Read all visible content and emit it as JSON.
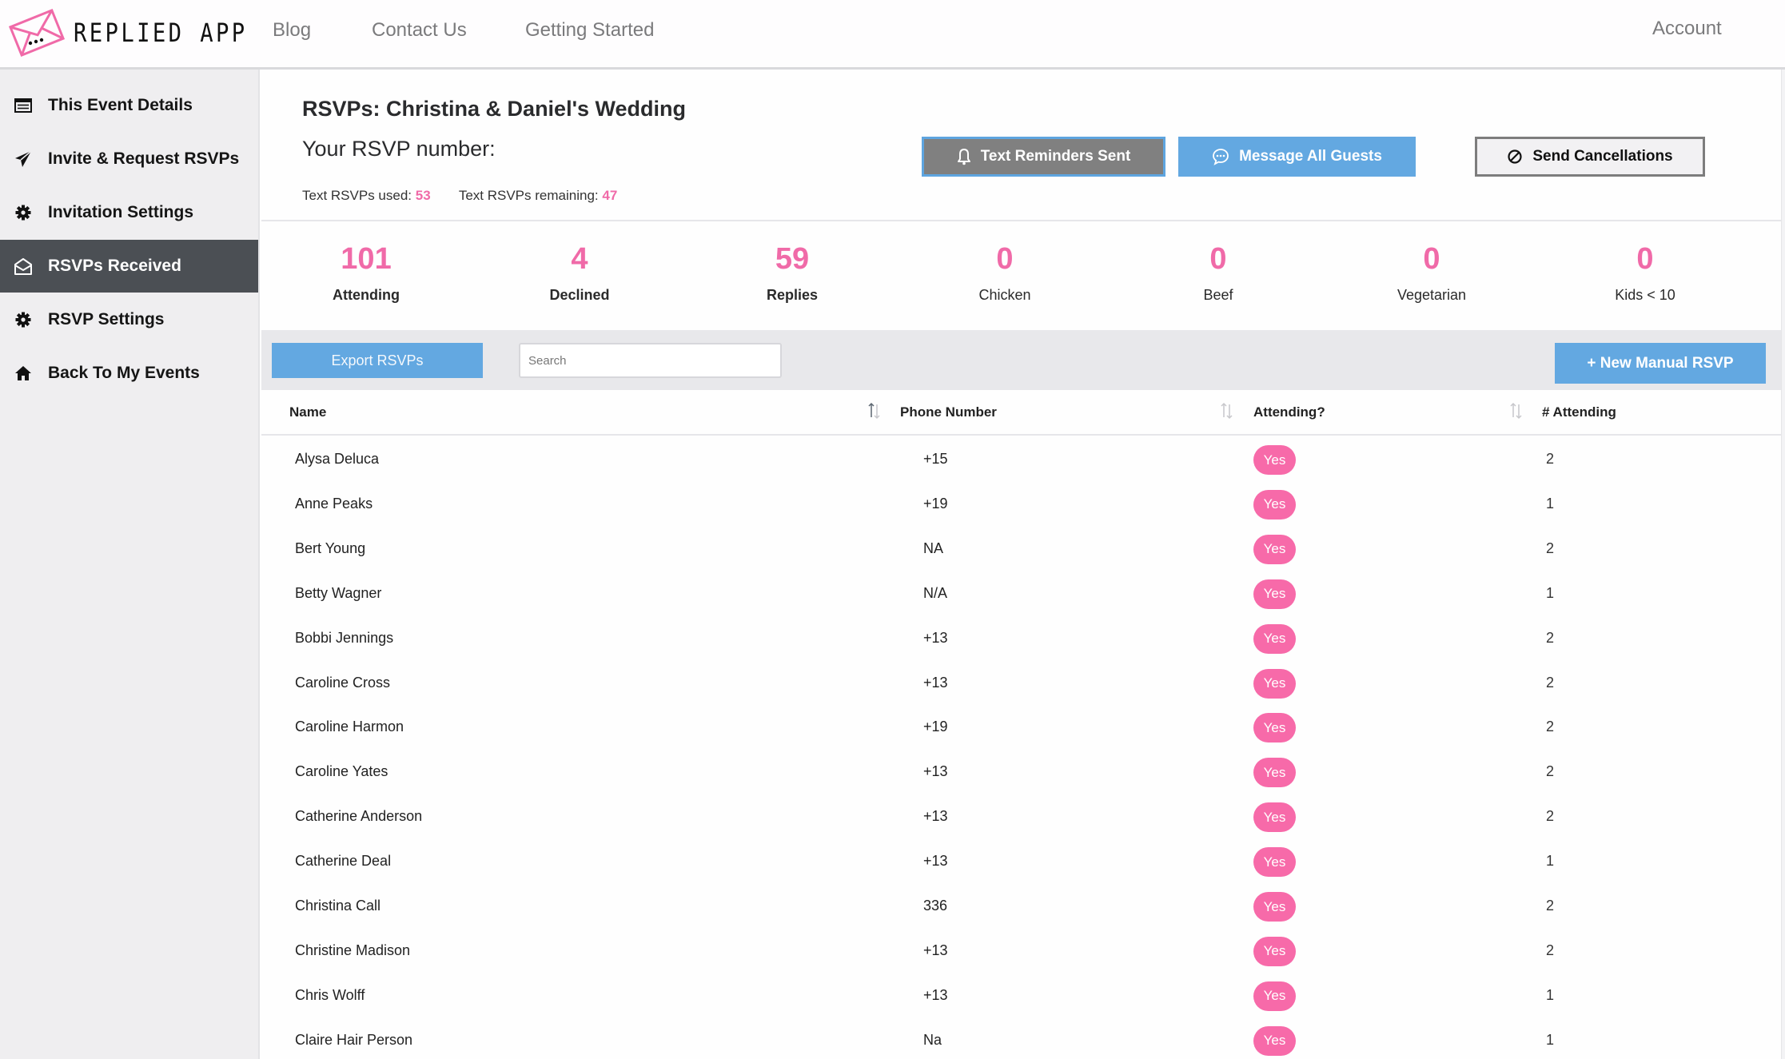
{
  "header": {
    "brand": "REPLIED APP",
    "nav": [
      "Blog",
      "Contact Us",
      "Getting Started"
    ],
    "account": "Account"
  },
  "sidebar": {
    "items": [
      {
        "label": "This Event Details",
        "icon": "list-icon"
      },
      {
        "label": "Invite & Request RSVPs",
        "icon": "paper-plane-icon"
      },
      {
        "label": "Invitation Settings",
        "icon": "gear-icon"
      },
      {
        "label": "RSVPs Received",
        "icon": "envelope-open-icon",
        "active": true
      },
      {
        "label": "RSVP Settings",
        "icon": "gear-icon"
      },
      {
        "label": "Back To My Events",
        "icon": "home-icon"
      }
    ]
  },
  "page": {
    "title": "RSVPs: Christina & Daniel's Wedding",
    "rsvp_number_label": "Your RSVP number:",
    "text_used_label": "Text RSVPs used:",
    "text_used": "53",
    "text_remaining_label": "Text RSVPs remaining:",
    "text_remaining": "47"
  },
  "actions": {
    "reminders": "Text Reminders Sent",
    "message": "Message All Guests",
    "cancel": "Send Cancellations"
  },
  "stats": [
    {
      "value": "101",
      "label": "Attending"
    },
    {
      "value": "4",
      "label": "Declined"
    },
    {
      "value": "59",
      "label": "Replies"
    },
    {
      "value": "0",
      "label": "Chicken"
    },
    {
      "value": "0",
      "label": "Beef"
    },
    {
      "value": "0",
      "label": "Vegetarian"
    },
    {
      "value": "0",
      "label": "Kids < 10"
    }
  ],
  "toolbar": {
    "export": "Export RSVPs",
    "search_placeholder": "Search",
    "search_value": "",
    "new_manual": "+ New Manual RSVP"
  },
  "table": {
    "columns": [
      "Name",
      "Phone Number",
      "Attending?",
      "# Attending"
    ],
    "rows": [
      {
        "name": "Alysa Deluca",
        "phone": "+15",
        "attending": "Yes",
        "count": "2"
      },
      {
        "name": "Anne Peaks",
        "phone": "+19",
        "attending": "Yes",
        "count": "1"
      },
      {
        "name": "Bert Young",
        "phone": "NA",
        "attending": "Yes",
        "count": "2"
      },
      {
        "name": "Betty Wagner",
        "phone": "N/A",
        "attending": "Yes",
        "count": "1"
      },
      {
        "name": "Bobbi Jennings",
        "phone": "+13",
        "attending": "Yes",
        "count": "2"
      },
      {
        "name": "Caroline Cross",
        "phone": "+13",
        "attending": "Yes",
        "count": "2"
      },
      {
        "name": "Caroline Harmon",
        "phone": "+19",
        "attending": "Yes",
        "count": "2"
      },
      {
        "name": "Caroline Yates",
        "phone": "+13",
        "attending": "Yes",
        "count": "2"
      },
      {
        "name": "Catherine Anderson",
        "phone": "+13",
        "attending": "Yes",
        "count": "2"
      },
      {
        "name": "Catherine Deal",
        "phone": "+13",
        "attending": "Yes",
        "count": "1"
      },
      {
        "name": "Christina Call",
        "phone": "336",
        "attending": "Yes",
        "count": "2"
      },
      {
        "name": "Christine Madison",
        "phone": "+13",
        "attending": "Yes",
        "count": "2"
      },
      {
        "name": "Chris Wolff",
        "phone": "+13",
        "attending": "Yes",
        "count": "1"
      },
      {
        "name": "Claire Hair Person",
        "phone": "Na",
        "attending": "Yes",
        "count": "1"
      }
    ]
  },
  "colors": {
    "accent_pink": "#f06aa8",
    "badge_pink": "#f76aa9",
    "primary_blue": "#63a8e1",
    "sidebar_active": "#4b4f54",
    "sidebar_bg": "#efeef0",
    "muted_gray": "#808080"
  }
}
